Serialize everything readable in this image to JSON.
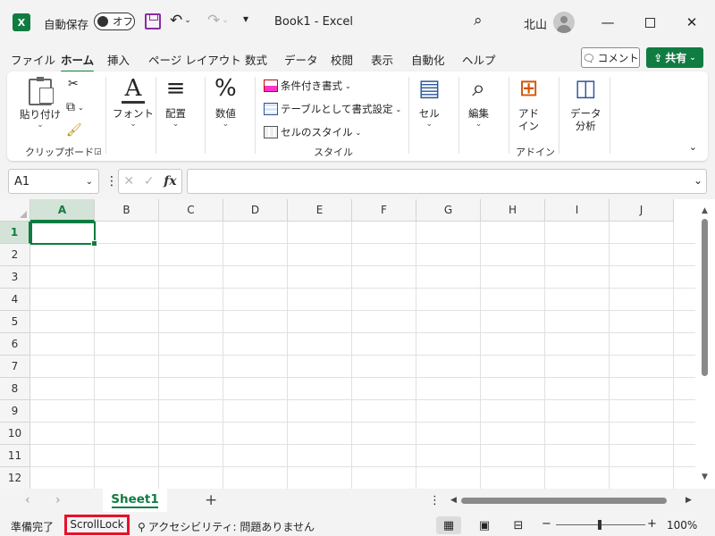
{
  "titlebar": {
    "app_logo": "X",
    "autosave_label": "自動保存",
    "autosave_state": "オフ",
    "doc_title": "Book1  -  Excel",
    "user_name": "北山",
    "icons": [
      "save-icon",
      "undo-icon",
      "redo-icon",
      "customize-qat-icon",
      "search-icon",
      "avatar",
      "minimize-icon",
      "maximize-icon",
      "close-icon"
    ]
  },
  "tabs": [
    "ファイル",
    "ホーム",
    "挿入",
    "ページ レイアウト",
    "数式",
    "データ",
    "校閲",
    "表示",
    "自動化",
    "ヘルプ"
  ],
  "active_tab": "ホーム",
  "comment_label": "コメント",
  "share_label": "共有",
  "ribbon": {
    "paste": "貼り付け",
    "clipboard_group": "クリップボード",
    "font": "フォント",
    "alignment": "配置",
    "number": "数値",
    "conditional": "条件付き書式",
    "table_format": "テーブルとして書式設定",
    "cell_styles": "セルのスタイル",
    "styles_group": "スタイル",
    "cells": "セル",
    "editing": "編集",
    "addins": "アド\nイン",
    "addins_1": "アド",
    "addins_2": "イン",
    "addins_group": "アドイン",
    "data_analysis_1": "データ",
    "data_analysis_2": "分析"
  },
  "formula_bar": {
    "name_box": "A1",
    "fx": "fx",
    "value": ""
  },
  "grid": {
    "columns": [
      "A",
      "B",
      "C",
      "D",
      "E",
      "F",
      "G",
      "H",
      "I",
      "J"
    ],
    "rows": [
      "1",
      "2",
      "3",
      "4",
      "5",
      "6",
      "7",
      "8",
      "9",
      "10",
      "11",
      "12"
    ],
    "active_cell": "A1"
  },
  "sheets": [
    "Sheet1"
  ],
  "status": {
    "ready": "準備完了",
    "scroll_lock": "ScrollLock",
    "accessibility": "アクセシビリティ: 問題ありません",
    "zoom": "100%"
  },
  "colors": {
    "accent": "#107c41",
    "highlight": "#e8102a"
  }
}
